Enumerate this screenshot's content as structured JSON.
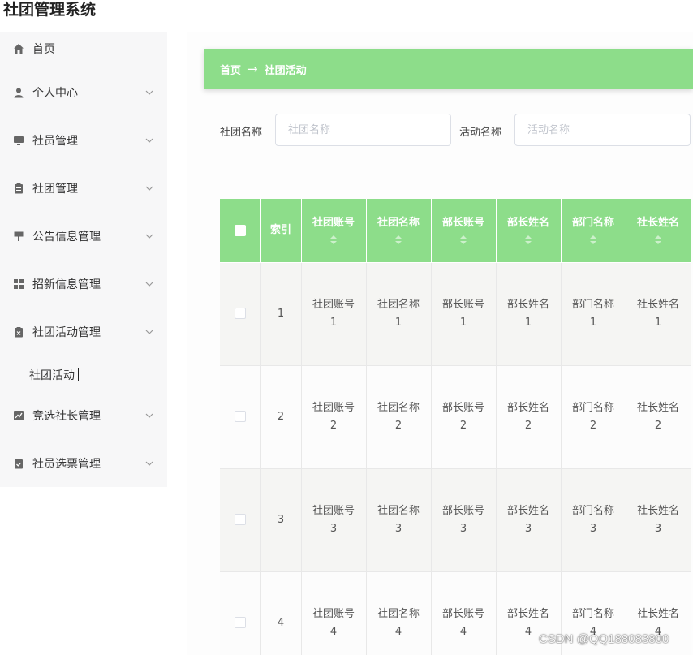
{
  "app": {
    "title": "社团管理系统"
  },
  "sidebar": {
    "items": [
      {
        "label": "首页"
      },
      {
        "label": "个人中心"
      },
      {
        "label": "社员管理"
      },
      {
        "label": "社团管理"
      },
      {
        "label": "公告信息管理"
      },
      {
        "label": "招新信息管理"
      },
      {
        "label": "社团活动管理"
      },
      {
        "label": "竞选社长管理"
      },
      {
        "label": "社员选票管理"
      }
    ],
    "sub_item": {
      "label": "社团活动"
    }
  },
  "breadcrumb": {
    "home": "首页",
    "arrow": "→",
    "current": "社团活动"
  },
  "search": {
    "club_name_label": "社团名称",
    "club_name_placeholder": "社团名称",
    "activity_name_label": "活动名称",
    "activity_name_placeholder": "活动名称"
  },
  "table": {
    "index_header": "索引",
    "columns": [
      "社团账号",
      "社团名称",
      "部长账号",
      "部长姓名",
      "部门名称",
      "社长姓名"
    ],
    "rows": [
      {
        "index": "1",
        "cells": [
          [
            "社团账号",
            "1"
          ],
          [
            "社团名称",
            "1"
          ],
          [
            "部长账号",
            "1"
          ],
          [
            "部长姓名",
            "1"
          ],
          [
            "部门名称",
            "1"
          ],
          [
            "社长姓名",
            "1"
          ]
        ]
      },
      {
        "index": "2",
        "cells": [
          [
            "社团账号",
            "2"
          ],
          [
            "社团名称",
            "2"
          ],
          [
            "部长账号",
            "2"
          ],
          [
            "部长姓名",
            "2"
          ],
          [
            "部门名称",
            "2"
          ],
          [
            "社长姓名",
            "2"
          ]
        ]
      },
      {
        "index": "3",
        "cells": [
          [
            "社团账号",
            "3"
          ],
          [
            "社团名称",
            "3"
          ],
          [
            "部长账号",
            "3"
          ],
          [
            "部长姓名",
            "3"
          ],
          [
            "部门名称",
            "3"
          ],
          [
            "社长姓名",
            "3"
          ]
        ]
      },
      {
        "index": "4",
        "cells": [
          [
            "社团账号",
            "4"
          ],
          [
            "社团名称",
            "4"
          ],
          [
            "部长账号",
            "4"
          ],
          [
            "部长姓名",
            "4"
          ],
          [
            "部门名称",
            "4"
          ],
          [
            "社长姓名",
            "4"
          ]
        ]
      }
    ]
  },
  "watermark": "CSDN @QQ188083800",
  "colors": {
    "accent_green": "#8ddd8a",
    "sidebar_bg": "#f7f7f8",
    "icon_gray": "#666666"
  }
}
